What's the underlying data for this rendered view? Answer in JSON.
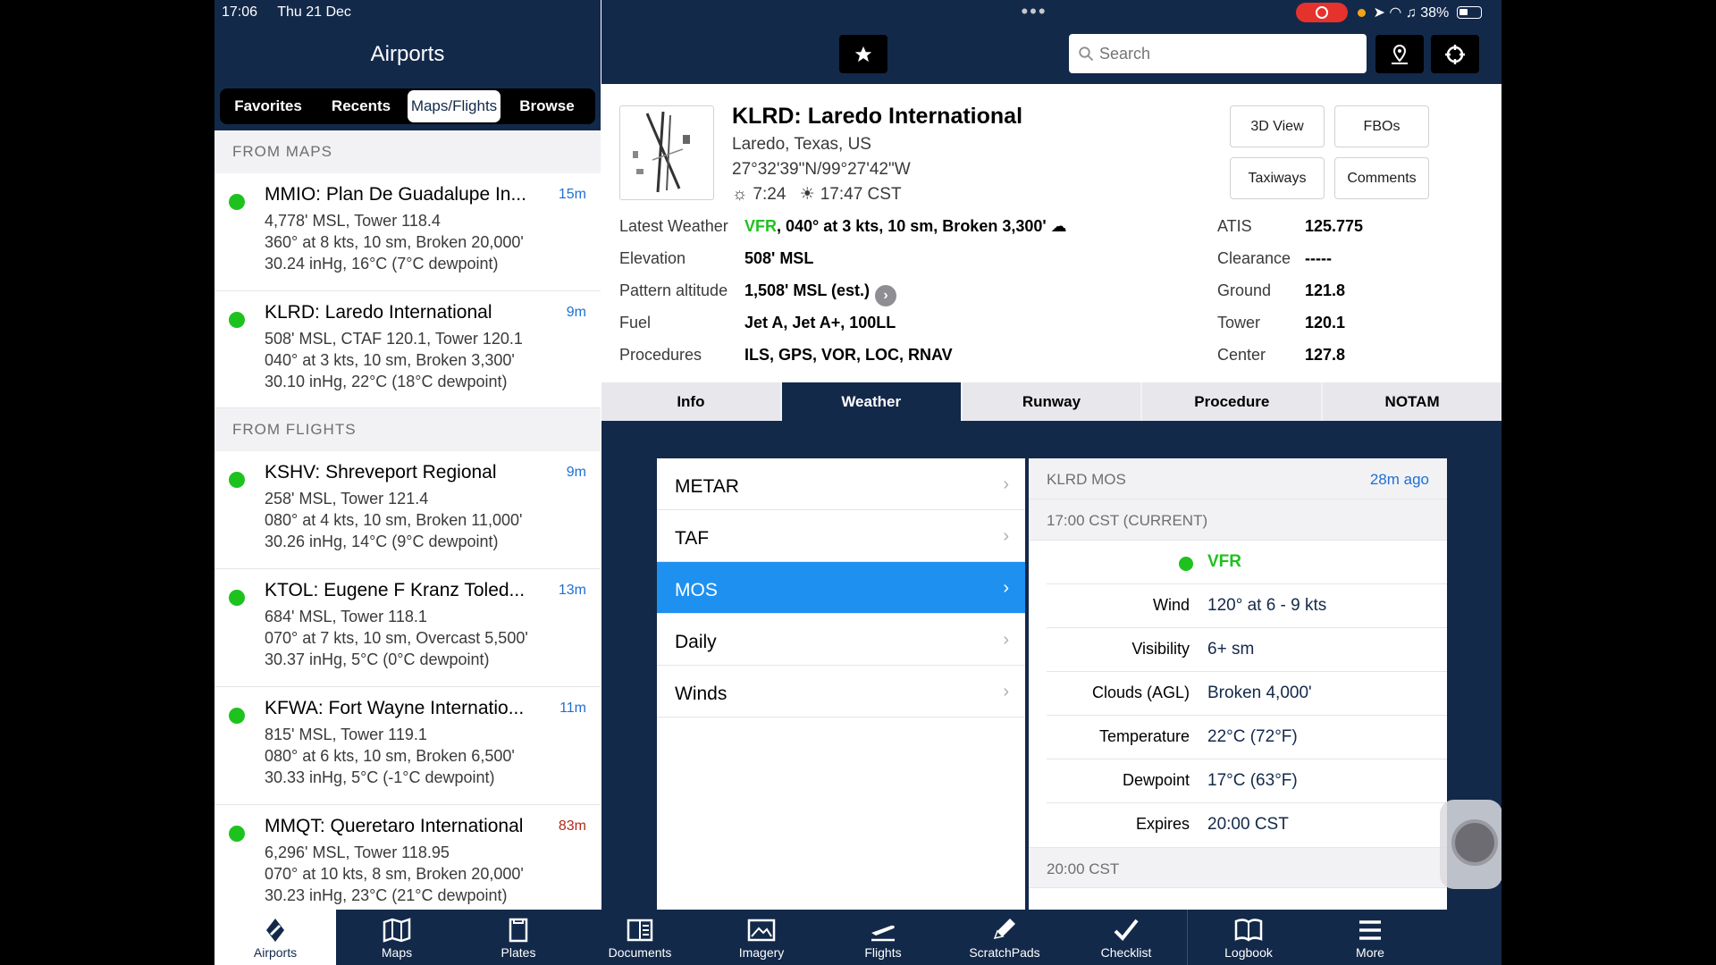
{
  "status": {
    "time": "17:06",
    "date": "Thu 21 Dec",
    "battery": "38%"
  },
  "left": {
    "title": "Airports",
    "segments": [
      "Favorites",
      "Recents",
      "Maps/Flights",
      "Browse"
    ],
    "from_maps_header": "FROM MAPS",
    "from_flights_header": "FROM FLIGHTS",
    "maps_items": [
      {
        "name": "MMIO: Plan De Guadalupe In...",
        "age": "15m",
        "line1": "4,778' MSL, Tower 118.4",
        "line2": "360° at 8 kts, 10 sm, Broken 20,000'",
        "line3": "30.24 inHg, 16°C (7°C dewpoint)"
      },
      {
        "name": "KLRD: Laredo International",
        "age": "9m",
        "line1": "508' MSL, CTAF 120.1, Tower 120.1",
        "line2": "040° at 3 kts, 10 sm, Broken 3,300'",
        "line3": "30.10 inHg, 22°C (18°C dewpoint)"
      }
    ],
    "flights_items": [
      {
        "name": "KSHV: Shreveport Regional",
        "age": "9m",
        "line1": "258' MSL, Tower 121.4",
        "line2": "080° at 4 kts, 10 sm, Broken 11,000'",
        "line3": "30.26 inHg, 14°C (9°C dewpoint)"
      },
      {
        "name": "KTOL: Eugene F Kranz Toled...",
        "age": "13m",
        "line1": "684' MSL, Tower 118.1",
        "line2": "070° at 7 kts, 10 sm, Overcast 5,500'",
        "line3": "30.37 inHg, 5°C (0°C dewpoint)"
      },
      {
        "name": "KFWA: Fort Wayne Internatio...",
        "age": "11m",
        "line1": "815' MSL, Tower 119.1",
        "line2": "080° at 6 kts, 10 sm, Broken 6,500'",
        "line3": "30.33 inHg, 5°C (-1°C dewpoint)"
      },
      {
        "name": "MMQT: Queretaro International",
        "age": "83m",
        "line1": "6,296' MSL, Tower 118.95",
        "line2": "070° at 10 kts, 8 sm, Broken 20,000'",
        "line3": "30.23 inHg, 23°C (21°C dewpoint)"
      }
    ]
  },
  "right": {
    "search_placeholder": "Search",
    "airport": {
      "title": "KLRD: Laredo International",
      "location": "Laredo, Texas, US",
      "coords": "27°32'39\"N/99°27'42\"W",
      "sunrise": "7:24",
      "sunset": "17:47 CST"
    },
    "buttons": {
      "view3d": "3D View",
      "fbos": "FBOs",
      "taxiways": "Taxiways",
      "comments": "Comments"
    },
    "details": {
      "latest_weather_label": "Latest Weather",
      "latest_weather_cat": "VFR",
      "latest_weather_rest": ", 040° at 3 kts, 10 sm, Broken 3,300'",
      "elevation_label": "Elevation",
      "elevation": "508' MSL",
      "pattern_label": "Pattern altitude",
      "pattern": "1,508' MSL (est.)",
      "fuel_label": "Fuel",
      "fuel": "Jet A, Jet A+, 100LL",
      "procedures_label": "Procedures",
      "procedures": "ILS, GPS, VOR, LOC, RNAV",
      "atis_label": "ATIS",
      "atis": "125.775",
      "clearance_label": "Clearance",
      "clearance": "-----",
      "ground_label": "Ground",
      "ground": "121.8",
      "tower_label": "Tower",
      "tower": "120.1",
      "center_label": "Center",
      "center": "127.8"
    },
    "tabs": [
      "Info",
      "Weather",
      "Runway",
      "Procedure",
      "NOTAM"
    ],
    "wx_menu": [
      "METAR",
      "TAF",
      "MOS",
      "Daily",
      "Winds"
    ],
    "mos": {
      "header": "KLRD MOS",
      "age": "28m ago",
      "period1": "17:00 CST (CURRENT)",
      "category": "VFR",
      "rows": [
        {
          "label": "Wind",
          "value": "120° at 6 - 9 kts"
        },
        {
          "label": "Visibility",
          "value": "6+ sm"
        },
        {
          "label": "Clouds (AGL)",
          "value": "Broken 4,000'"
        },
        {
          "label": "Temperature",
          "value": "22°C (72°F)"
        },
        {
          "label": "Dewpoint",
          "value": "17°C (63°F)"
        },
        {
          "label": "Expires",
          "value": "20:00 CST"
        }
      ],
      "period2": "20:00 CST"
    }
  },
  "toolbar": [
    "Airports",
    "Maps",
    "Plates",
    "Documents",
    "Imagery",
    "Flights",
    "ScratchPads",
    "Checklist",
    "Logbook",
    "More"
  ],
  "colors": {
    "navy": "#13294a",
    "accent_blue": "#1e90f0",
    "vfr_green": "#1ec21e"
  }
}
